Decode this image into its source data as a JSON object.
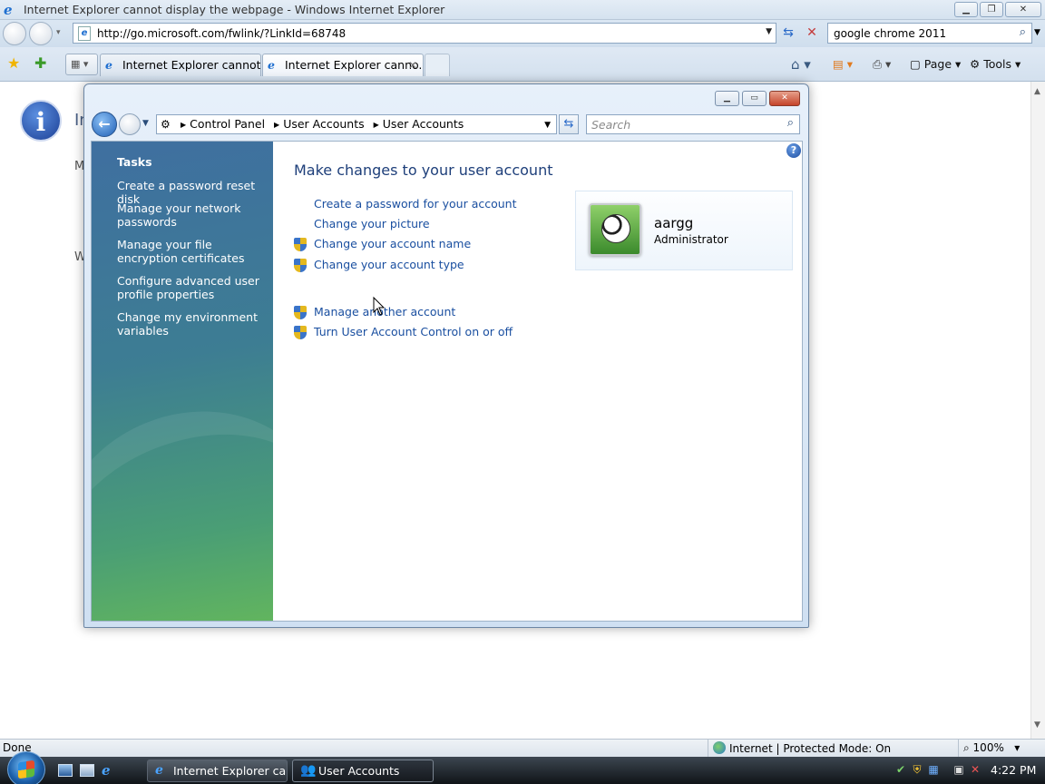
{
  "ie": {
    "window_title": "Internet Explorer cannot display the webpage - Windows Internet Explorer",
    "address": "http://go.microsoft.com/fwlink/?LinkId=68748",
    "search_value": "google chrome 2011",
    "tabs": [
      {
        "label": "Internet Explorer cannot di..."
      },
      {
        "label": "Internet Explorer canno..."
      }
    ],
    "commands": {
      "page": "Page",
      "tools": "Tools"
    },
    "page_fragments": {
      "heading": "In",
      "line1": "M",
      "line2": "W"
    },
    "status": {
      "left": "Done",
      "zone": "Internet | Protected Mode: On",
      "zoom": "100%"
    }
  },
  "taskbar": {
    "buttons": [
      {
        "label": "Internet Explorer ca..."
      },
      {
        "label": "User Accounts"
      }
    ],
    "clock": "4:22 PM"
  },
  "control_panel": {
    "breadcrumbs": [
      "Control Panel",
      "User Accounts",
      "User Accounts"
    ],
    "search_placeholder": "Search",
    "tasks_heading": "Tasks",
    "tasks": [
      "Create a password reset disk",
      "Manage your network passwords",
      "Manage your file encryption certificates",
      "Configure advanced user profile properties",
      "Change my environment variables"
    ],
    "heading": "Make changes to your user account",
    "links": [
      {
        "label": "Create a password for your account",
        "shield": false
      },
      {
        "label": "Change your picture",
        "shield": false
      },
      {
        "label": "Change your account name",
        "shield": true
      },
      {
        "label": "Change your account type",
        "shield": true
      },
      {
        "label": "Manage another account",
        "shield": true
      },
      {
        "label": "Turn User Account Control on or off",
        "shield": true
      }
    ],
    "user": {
      "name": "aargg",
      "role": "Administrator"
    }
  }
}
